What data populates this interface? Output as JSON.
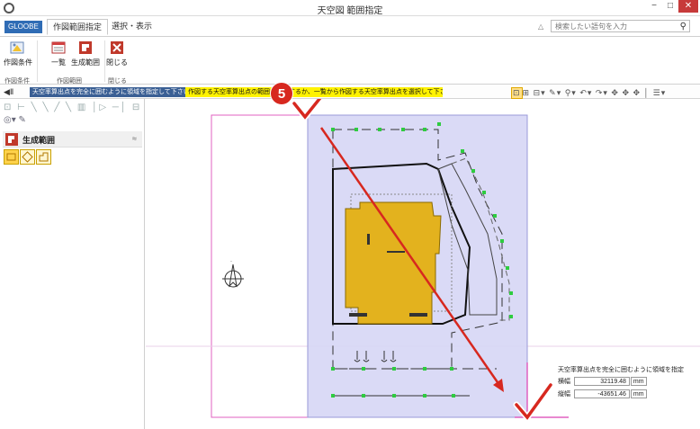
{
  "window": {
    "title": "天空図 範囲指定",
    "minimize": "−",
    "maximize": "□",
    "close": "✕"
  },
  "tabs": {
    "gloobe": "GLOOBE",
    "active": "作図範囲指定",
    "view": "選択・表示"
  },
  "search": {
    "placeholder": "検索したい語句を入力"
  },
  "ribbon": {
    "buttons": [
      {
        "label": "作図条件"
      },
      {
        "label": "一覧"
      },
      {
        "label": "生成範囲"
      },
      {
        "label": "閉じる"
      }
    ],
    "groups": [
      "作図条件",
      "作図範囲",
      "閉じる"
    ]
  },
  "command": {
    "dark_message": "天空率算出点を完全に囲むように領域を指定して下さい。",
    "yellow_message": "作図する天空率算出点の範囲を指定するか、一覧から作図する天空率算出点を選択して下さい。"
  },
  "left_panel": {
    "section_title": "生成範囲"
  },
  "dialog": {
    "title": "天空率算出点を完全に囲むように領域を指定",
    "width_label": "横幅",
    "width_value": "32119.48",
    "height_label": "縦幅",
    "height_value": "-43651.46",
    "unit": "mm"
  },
  "annotation": {
    "step": "5"
  },
  "colors": {
    "accent": "#2f6cb5",
    "selection_fill": "#d6d6f5",
    "building_fill": "#e3b21e",
    "arrow": "#d7281f",
    "boundary": "#e060c0"
  }
}
